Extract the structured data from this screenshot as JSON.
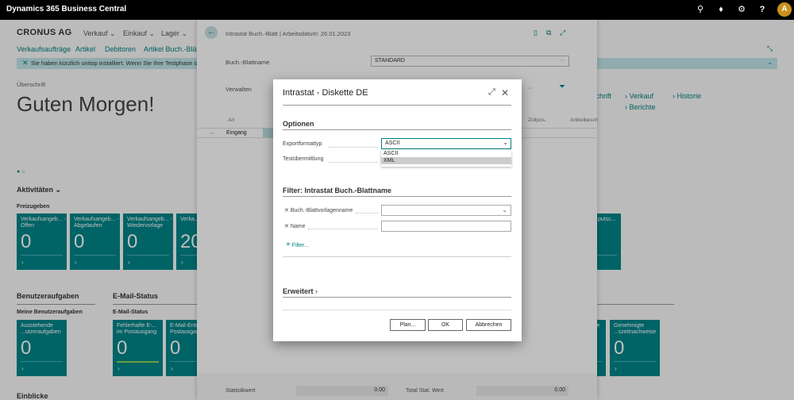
{
  "app": {
    "title": "Dynamics 365 Business Central",
    "avatar": "A"
  },
  "home": {
    "company": "CRONUS AG",
    "menu": [
      "Verkauf",
      "Einkauf",
      "Lager"
    ],
    "nav": [
      "Verkaufsaufträge",
      "Artikel",
      "Debitoren",
      "Artikel Buch.-Blätter"
    ],
    "notice": "Sie haben kürzlich unitop installiert. Wenn Sie Ihre Testphase sta",
    "ueberschrift": "Überschrift",
    "greeting": "Guten Morgen!",
    "right_links": [
      "schrift",
      "Verkauf",
      "Historie",
      "Berichte"
    ],
    "activities": "Aktivitäten",
    "freizugeben": "Freizugeben",
    "tiles": [
      {
        "label": "Verkaufsangeb... - Offen",
        "value": "0"
      },
      {
        "label": "Verkaufsangeb... - Abgelaufen",
        "value": "0"
      },
      {
        "label": "Verkaufsangeb... - Wiedervorlage",
        "value": "0"
      },
      {
        "label": "Verka... - Offe",
        "value": "20"
      },
      {
        "label": "putsc...",
        "value": ""
      }
    ],
    "user_tasks": "Benutzeraufgaben",
    "my_tasks": "Meine Benutzeraufgaben",
    "email_status": "E-Mail-Status",
    "email_status_sub": "E-Mail-Status",
    "tiles2": [
      {
        "label": "Ausstehende ...utzeraufgaben",
        "value": "0"
      },
      {
        "label": "Fehlerhafte E-... im Postausgang",
        "value": "0"
      },
      {
        "label": "E-Mail-Entw... im Postausgang",
        "value": "0"
      },
      {
        "label": "se",
        "value": "0"
      },
      {
        "label": "Genehmigte ...szeitnachweise",
        "value": "0"
      }
    ],
    "einblicke": "Einblicke"
  },
  "sheet": {
    "title": "Intrastat Buch.-Blatt | Arbeitsdatum: 26.01.2023",
    "batch_label": "Buch.-Blattname",
    "batch_value": "STANDARD",
    "verwalten": "Verwalten",
    "col_art": "Art",
    "col_zollpos": "Zollpos.",
    "col_artikel": "Artikelbesch",
    "row_value": "Eingang",
    "stat_label": "Statistikwert",
    "stat_value": "0.00",
    "total_label": "Total Stat. Wert",
    "total_value": "0.00"
  },
  "dialog": {
    "title": "Intrastat - Diskette DE",
    "options_header": "Optionen",
    "export_label": "Exportformattyp",
    "export_value": "ASCII",
    "export_options": [
      "ASCII",
      "XML"
    ],
    "test_label": "Testübermittlung",
    "filter_header": "Filter: Intrastat Buch.-Blattname",
    "template_label": "Buch.-Blattvorlagenname",
    "name_label": "Name",
    "filter_link": "Filter...",
    "advanced": "Erweitert",
    "btn_plan": "Plan...",
    "btn_ok": "OK",
    "btn_cancel": "Abbrechen"
  }
}
